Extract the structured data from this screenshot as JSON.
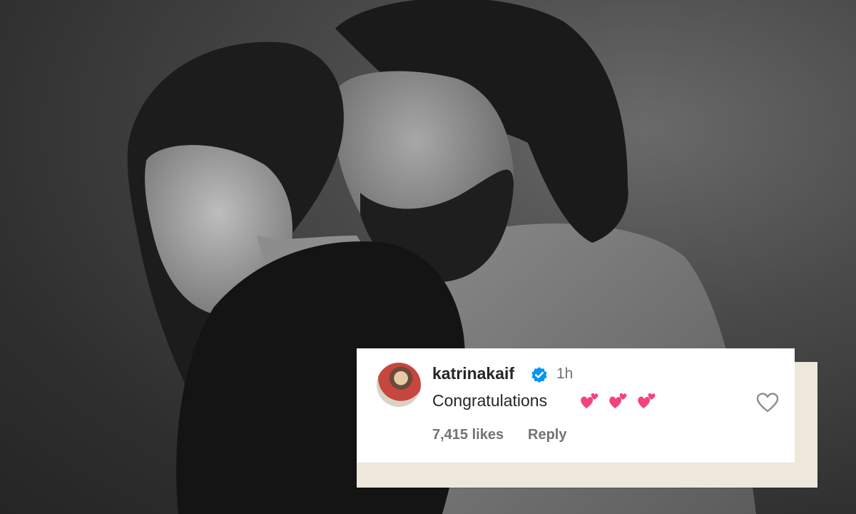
{
  "comment": {
    "username": "katrinakaif",
    "time": "1h",
    "text": "Congratulations",
    "emoji": [
      "two-hearts",
      "two-hearts",
      "two-hearts"
    ],
    "likes": "7,415 likes",
    "reply_label": "Reply"
  },
  "colors": {
    "verified": "#0095f6",
    "emoji_heart": "#f2447c",
    "text_primary": "#262626",
    "text_secondary": "#737373",
    "paper": "#ede7dc"
  }
}
